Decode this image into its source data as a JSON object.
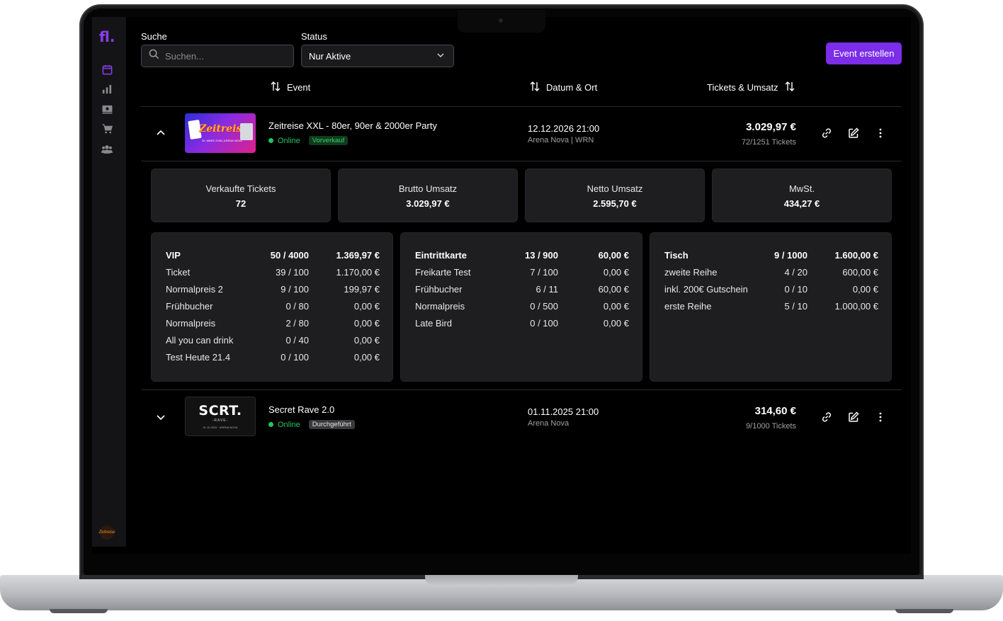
{
  "sidebar": {
    "logo": "fl.",
    "avatar_text": "Zeitreise"
  },
  "filters": {
    "search_label": "Suche",
    "search_placeholder": "Suchen...",
    "status_label": "Status",
    "status_value": "Nur Aktive",
    "create_button": "Event erstellen"
  },
  "columns": {
    "event": "Event",
    "date": "Datum & Ort",
    "tickets": "Tickets & Umsatz"
  },
  "events": [
    {
      "title": "Zeitreise XXL - 80er, 90er & 2000er Party",
      "status": "Online",
      "badge": "Vorverkauf",
      "date": "12.12.2026 21:00",
      "location": "Arena Nova | WRN",
      "revenue": "3.029,97 €",
      "tickets": "72/1251 Tickets",
      "thumb_text": "Zeitreise",
      "thumb_sub": "20. MÄRZ 2026 | ARENA NOVA"
    },
    {
      "title": "Secret Rave 2.0",
      "status": "Online",
      "badge": "Durchgeführt",
      "date": "01.11.2025 21:00",
      "location": "Arena Nova",
      "revenue": "314,60 €",
      "tickets": "9/1000 Tickets",
      "thumb_text": "SCRT.",
      "thumb_sub": "-RAVE-",
      "thumb_sub2": "01.10.2025 · ARENA NOVA"
    }
  ],
  "stats": [
    {
      "label": "Verkaufte Tickets",
      "value": "72"
    },
    {
      "label": "Brutto Umsatz",
      "value": "3.029,97 €"
    },
    {
      "label": "Netto Umsatz",
      "value": "2.595,70 €"
    },
    {
      "label": "MwSt.",
      "value": "434,27 €"
    }
  ],
  "ticket_groups": [
    {
      "header": {
        "name": "VIP",
        "count": "50 / 4000",
        "price": "1.369,97 €"
      },
      "rows": [
        {
          "name": "Ticket",
          "count": "39 / 100",
          "price": "1.170,00 €"
        },
        {
          "name": "Normalpreis 2",
          "count": "9 / 100",
          "price": "199,97 €"
        },
        {
          "name": "Frühbucher",
          "count": "0 / 80",
          "price": "0,00 €"
        },
        {
          "name": "Normalpreis",
          "count": "2 / 80",
          "price": "0,00 €"
        },
        {
          "name": "All you can drink",
          "count": "0 / 40",
          "price": "0,00 €"
        },
        {
          "name": "Test Heute 21.4",
          "count": "0 / 100",
          "price": "0,00 €"
        }
      ]
    },
    {
      "header": {
        "name": "Eintrittkarte",
        "count": "13 / 900",
        "price": "60,00 €"
      },
      "rows": [
        {
          "name": "Freikarte Test",
          "count": "7 / 100",
          "price": "0,00 €"
        },
        {
          "name": "Frühbucher",
          "count": "6 / 11",
          "price": "60,00 €"
        },
        {
          "name": "Normalpreis",
          "count": "0 / 500",
          "price": "0,00 €"
        },
        {
          "name": "Late Bird",
          "count": "0 / 100",
          "price": "0,00 €"
        }
      ]
    },
    {
      "header": {
        "name": "Tisch",
        "count": "9 / 1000",
        "price": "1.600,00 €"
      },
      "rows": [
        {
          "name": "zweite Reihe",
          "count": "4 / 20",
          "price": "600,00 €"
        },
        {
          "name": "inkl. 200€ Gutschein",
          "count": "0 / 10",
          "price": "0,00 €"
        },
        {
          "name": "erste Reihe",
          "count": "5 / 10",
          "price": "1.000,00 €"
        }
      ]
    }
  ],
  "colors": {
    "accent": "#7c2de8",
    "online": "#22c55e",
    "background": "#000000",
    "card": "#1e1e20"
  }
}
